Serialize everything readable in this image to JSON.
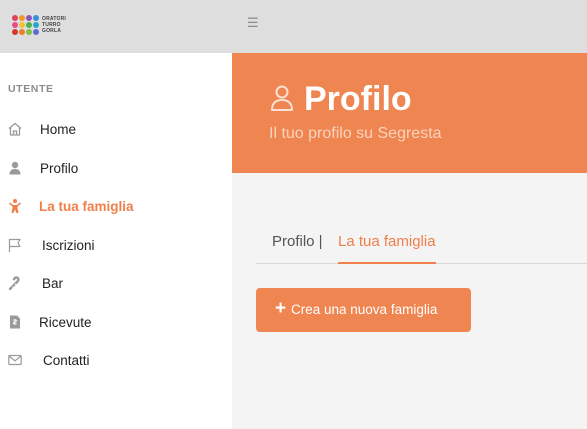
{
  "logo": {
    "lines": [
      "ORATORI",
      "TURRO",
      "GORLA"
    ],
    "dot_colors": [
      "#e0405a",
      "#f09a2b",
      "#8c53b8",
      "#3b8fd6",
      "#e94b8a",
      "#f2c232",
      "#4bb04f",
      "#2aa6c9",
      "#d6362d",
      "#f07d2a",
      "#7cc242",
      "#5a6fd1"
    ]
  },
  "topbar": {
    "menu_icon": "hamburger-icon"
  },
  "sidebar": {
    "heading": "UTENTE",
    "items": [
      {
        "label": "Home",
        "icon": "home-icon"
      },
      {
        "label": "Profilo",
        "icon": "user-icon"
      },
      {
        "label": "La tua famiglia",
        "icon": "child-icon",
        "active": true
      },
      {
        "label": "Iscrizioni",
        "icon": "flag-icon"
      },
      {
        "label": "Bar",
        "icon": "candy-cane-icon"
      },
      {
        "label": "Ricevute",
        "icon": "receipt-icon"
      },
      {
        "label": "Contatti",
        "icon": "envelope-icon"
      }
    ]
  },
  "header": {
    "icon": "user-outline-icon",
    "title": "Profilo",
    "subtitle": "Il tuo profilo su Segresta"
  },
  "tabs": [
    {
      "label": "Profilo |"
    },
    {
      "label": "La tua famiglia",
      "active": true
    }
  ],
  "actions": {
    "create_family_label": "Crea una nuova famiglia"
  },
  "colors": {
    "accent": "#ef8551",
    "topbar": "#dedede",
    "sidebar": "#ffffff"
  }
}
